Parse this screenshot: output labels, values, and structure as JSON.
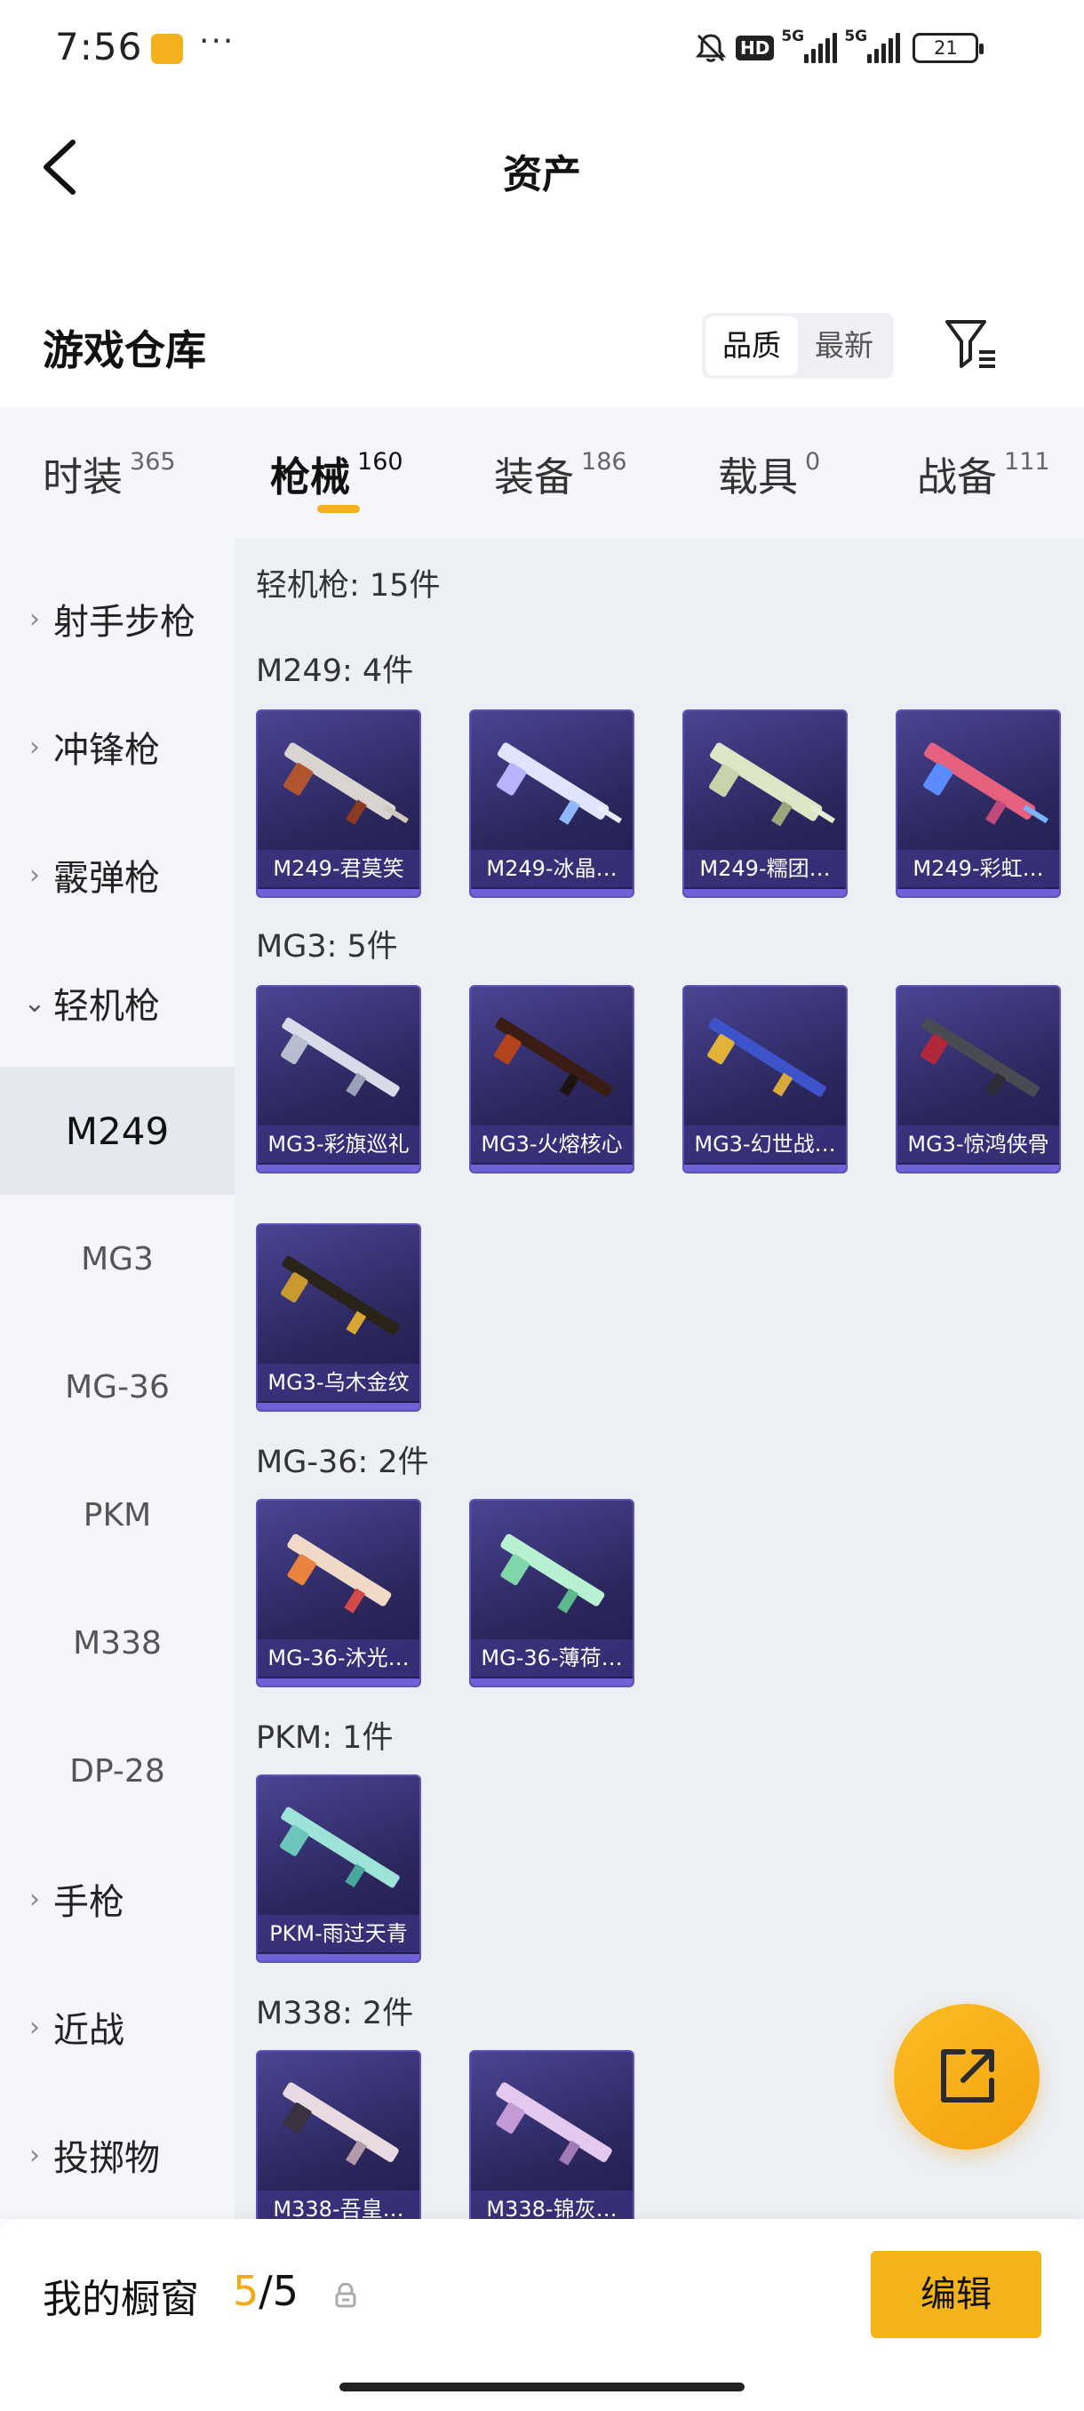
{
  "status_bar": {
    "time": "7:56",
    "more": "···",
    "hd": "HD",
    "net1": "5G",
    "net2": "5G",
    "battery": "21"
  },
  "header": {
    "title": "资产"
  },
  "warehouse": {
    "title": "游戏仓库",
    "sort_quality": "品质",
    "sort_newest": "最新"
  },
  "tabs": [
    {
      "label": "时装",
      "count": "365"
    },
    {
      "label": "枪械",
      "count": "160"
    },
    {
      "label": "装备",
      "count": "186"
    },
    {
      "label": "载具",
      "count": "0"
    },
    {
      "label": "战备",
      "count": "111"
    }
  ],
  "sidebar": {
    "items": [
      {
        "label": "射手步枪"
      },
      {
        "label": "冲锋枪"
      },
      {
        "label": "霰弹枪"
      },
      {
        "label": "轻机枪"
      },
      {
        "label": "M249"
      },
      {
        "label": "MG3"
      },
      {
        "label": "MG-36"
      },
      {
        "label": "PKM"
      },
      {
        "label": "M338"
      },
      {
        "label": "DP-28"
      },
      {
        "label": "手枪"
      },
      {
        "label": "近战"
      },
      {
        "label": "投掷物"
      }
    ]
  },
  "content": {
    "category_header": "轻机枪: 15件",
    "groups": [
      {
        "header": "M249: 4件",
        "items": [
          "M249-君莫笑",
          "M249-冰晶…",
          "M249-糯团…",
          "M249-彩虹…"
        ]
      },
      {
        "header": "MG3: 5件",
        "items": [
          "MG3-彩旗巡礼",
          "MG3-火熔核心",
          "MG3-幻世战…",
          "MG3-惊鸿侠骨",
          "MG3-乌木金纹"
        ]
      },
      {
        "header": "MG-36: 2件",
        "items": [
          "MG-36-沐光…",
          "MG-36-薄荷…"
        ]
      },
      {
        "header": "PKM: 1件",
        "items": [
          "PKM-雨过天青"
        ]
      },
      {
        "header": "M338: 2件",
        "items": [
          "M338-吾皇…",
          "M338-锦灰…"
        ]
      }
    ]
  },
  "bottom": {
    "label": "我的橱窗",
    "current": "5",
    "separator": "/",
    "total": "5",
    "edit_label": "编辑"
  },
  "colors": {
    "accent": "#f5b01f",
    "card_bg": "#2c285f",
    "card_border": "#5d54b8"
  }
}
